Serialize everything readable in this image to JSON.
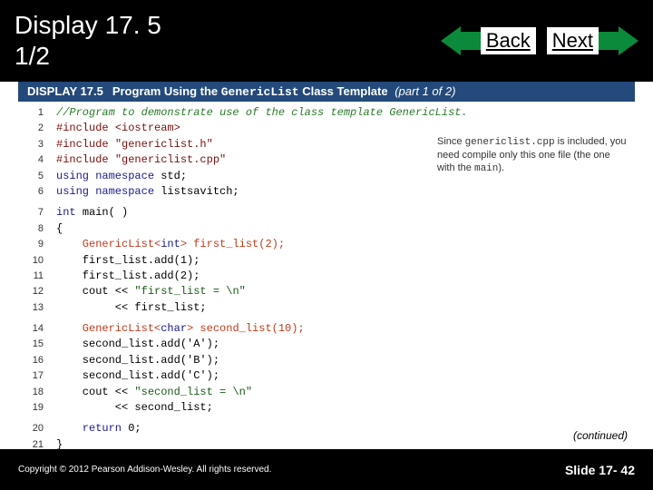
{
  "header": {
    "title_line1": "Display 17. 5",
    "title_line2": "1/2",
    "back_label": "Back",
    "next_label": "Next"
  },
  "display_strip": {
    "label": "DISPLAY 17.5",
    "title_before": "Program Using the ",
    "title_mono": "GenericList",
    "title_after": " Class Template",
    "part": " (part 1 of 2)"
  },
  "note": {
    "t1": "Since ",
    "mono": "genericlist.cpp",
    "t2": " is included, you need compile only this one file (the one with the ",
    "mono2": "main",
    "t3": ")."
  },
  "code": {
    "l1": "//Program to demonstrate use of the class template GenericList.",
    "l2a": "#include ",
    "l2b": "<iostream>",
    "l3a": "#include ",
    "l3b": "\"genericlist.h\"",
    "l4a": "#include ",
    "l4b": "\"genericlist.cpp\"",
    "l5a": "using namespace ",
    "l5b": "std;",
    "l6a": "using namespace ",
    "l6b": "listsavitch;",
    "l7a": "int ",
    "l7b": "main( )",
    "l8": "{",
    "l9a": "    GenericList<",
    "l9b": "int",
    "l9c": "> first_list(2);",
    "l10": "    first_list.add(1);",
    "l11": "    first_list.add(2);",
    "l12a": "    cout << ",
    "l12b": "\"first_list = \\n\"",
    "l13": "         << first_list;",
    "l14a": "    GenericList<",
    "l14b": "char",
    "l14c": "> second_list(10);",
    "l15": "    second_list.add('A');",
    "l16": "    second_list.add('B');",
    "l17": "    second_list.add('C');",
    "l18a": "    cout << ",
    "l18b": "\"second_list = \\n\"",
    "l19": "         << second_list;",
    "l20a": "    return ",
    "l20b": "0;",
    "l21": "}"
  },
  "continued": "(continued)",
  "footer": {
    "copyright": "Copyright © 2012 Pearson Addison-Wesley. All rights reserved.",
    "slide": "Slide 17- 42"
  }
}
